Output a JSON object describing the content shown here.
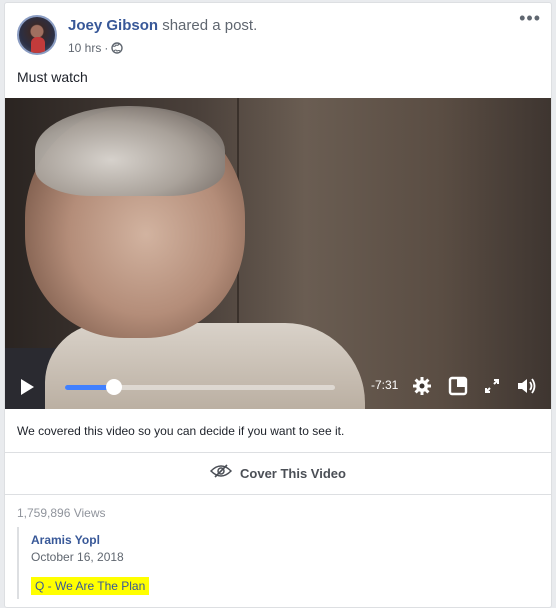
{
  "post": {
    "author_name": "Joey Gibson",
    "action_text": "shared a post.",
    "timestamp": "10 hrs",
    "separator": "·",
    "audience_icon": "globe-icon",
    "more_icon": "more-options-icon",
    "text": "Must watch"
  },
  "video": {
    "time_remaining": "-7:31",
    "progress_fraction": 0.18,
    "controls": [
      "play-icon",
      "gear-icon",
      "picture-in-picture-icon",
      "fullscreen-icon",
      "volume-icon"
    ],
    "progress_color": "#4080ff"
  },
  "warning": {
    "text": "We covered this video so you can decide if you want to see it."
  },
  "cover_button": {
    "label": "Cover This Video",
    "icon": "eye-slash-icon"
  },
  "stats": {
    "views": "1,759,896 Views"
  },
  "shared": {
    "author": "Aramis Yopl",
    "date": "October 16, 2018",
    "title": "Q - We Are The Plan",
    "highlight_color": "#ffff00"
  },
  "colors": {
    "link": "#385898",
    "text": "#1d2129",
    "muted": "#606770"
  }
}
